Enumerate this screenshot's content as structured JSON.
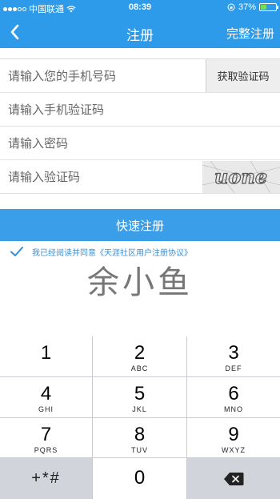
{
  "status_bar": {
    "carrier": "中国联通",
    "time": "08:39",
    "battery": "37%",
    "battery_level": 0.37
  },
  "nav": {
    "title": "注册",
    "action_label": "完整注册",
    "back_icon": "chevron-left-icon"
  },
  "form": {
    "phone_placeholder": "请输入您的手机号码",
    "get_code_label": "获取验证码",
    "sms_code_placeholder": "请输入手机验证码",
    "password_placeholder": "请输入密码",
    "captcha_placeholder": "请输入验证码",
    "captcha_text": "uone"
  },
  "submit_label": "快速注册",
  "agreement": {
    "checked": true,
    "text": "我已经阅读并同意《天涯社区用户注册协议》"
  },
  "watermark": "余小鱼",
  "keyboard": {
    "keys": [
      {
        "num": "1",
        "letters": ""
      },
      {
        "num": "2",
        "letters": "ABC"
      },
      {
        "num": "3",
        "letters": "DEF"
      },
      {
        "num": "4",
        "letters": "GHI"
      },
      {
        "num": "5",
        "letters": "JKL"
      },
      {
        "num": "6",
        "letters": "MNO"
      },
      {
        "num": "7",
        "letters": "PQRS"
      },
      {
        "num": "8",
        "letters": "TUV"
      },
      {
        "num": "9",
        "letters": "WXYZ"
      }
    ],
    "symbols_label": "+*#",
    "zero": "0"
  },
  "colors": {
    "brand_blue": "#2e9bea",
    "button_blue": "#3a9ee8",
    "link_blue": "#3a8fd6"
  }
}
